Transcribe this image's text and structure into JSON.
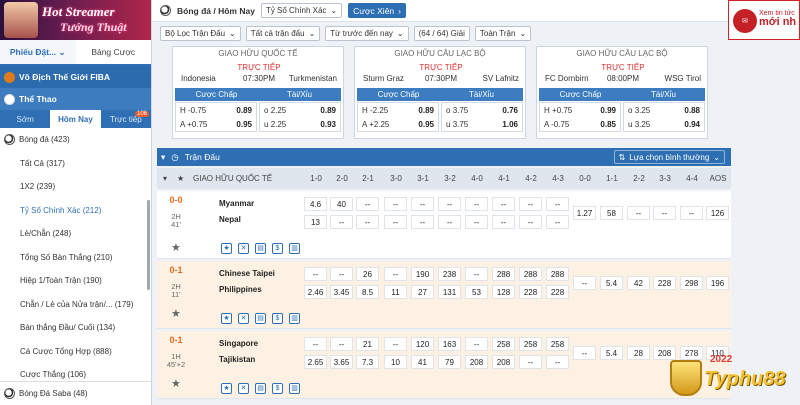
{
  "banner": {
    "line1": "Hot Streamer",
    "line2": "Tướng Thuật"
  },
  "sidebar": {
    "tabs": [
      "Phiếu Đặt...",
      "Bảng Cược"
    ],
    "fiba": "Vô Địch Thế Giới FIBA",
    "sport": "Thể Thao",
    "subtabs": [
      "Sớm",
      "Hôm Nay",
      "Trực tiếp"
    ],
    "live_badge": "106",
    "football": "Bóng đá (423)",
    "items": [
      "Tất Cả (317)",
      "1X2 (239)",
      "Tỷ Số Chính Xác (212)",
      "Lẻ/Chẵn (248)",
      "Tổng Số Bàn Thắng (210)",
      "Hiệp 1/Toàn Trận (190)",
      "Chẵn / Lẻ của Nửa trận/... (179)",
      "Bàn thắng Đầu/ Cuối (134)",
      "Cá Cược Tổng Hợp (888)",
      "Cược Thắng (106)"
    ],
    "saba": "Bóng Đá Saba (48)"
  },
  "topbar": {
    "title": "Bóng đá / Hôm Nay",
    "market": "Tỷ Số Chính Xác",
    "button": "Cược Xiên"
  },
  "filters": {
    "f1": "Bộ Lọc Trận Đấu",
    "f2": "Tất cả trận đấu",
    "f3": "Từ trước đến nay",
    "f4": "(64 / 64) Giải",
    "f5": "Toàn Trận"
  },
  "ad": {
    "small": "Xem tin tức",
    "big": "mới nh"
  },
  "cards": [
    {
      "league": "GIAO HỮU QUỐC TẾ",
      "home": "Indonesia",
      "away": "Turkmenistan",
      "live": "TRỰC TIẾP",
      "time": "07:30PM",
      "h1": "Cược Chấp",
      "h2": "Tài/Xỉu",
      "o": [
        [
          "H",
          "-0.75",
          "0.89"
        ],
        [
          "A",
          "+0.75",
          "0.95"
        ],
        [
          "o",
          "2.25",
          "0.89"
        ],
        [
          "u",
          "2.25",
          "0.93"
        ]
      ]
    },
    {
      "league": "GIAO HỮU CÂU LẠC BỘ",
      "home": "Sturm Graz",
      "away": "SV Lafnitz",
      "live": "TRỰC TIẾP",
      "time": "07:30PM",
      "h1": "Cược Chấp",
      "h2": "Tài/Xỉu",
      "o": [
        [
          "H",
          "-2.25",
          "0.89"
        ],
        [
          "A",
          "+2.25",
          "0.95"
        ],
        [
          "o",
          "3.75",
          "0.76"
        ],
        [
          "u",
          "3.75",
          "1.06"
        ]
      ]
    },
    {
      "league": "GIAO HỮU CÂU LẠC BỘ",
      "home": "FC Dornbirn",
      "away": "WSG Tirol",
      "live": "TRỰC TIẾP",
      "time": "08:00PM",
      "h1": "Cược Chấp",
      "h2": "Tài/Xỉu",
      "o": [
        [
          "H",
          "+0.75",
          "0.99"
        ],
        [
          "A",
          "-0.75",
          "0.85"
        ],
        [
          "o",
          "3.25",
          "0.88"
        ],
        [
          "u",
          "3.25",
          "0.94"
        ]
      ]
    }
  ],
  "table": {
    "title": "Trận Đấu",
    "sort": "Lựa chọn bình thường",
    "league": "GIAO HỮU QUỐC TẾ",
    "cols": [
      "1-0",
      "2-0",
      "2-1",
      "3-0",
      "3-1",
      "3-2",
      "4-0",
      "4-1",
      "4-2",
      "4-3",
      "0-0",
      "1-1",
      "2-2",
      "3-3",
      "4-4",
      "AOS"
    ],
    "rows": [
      {
        "score": "0-0",
        "half": "2H",
        "min": "41'",
        "home": "Myanmar",
        "away": "Nepal",
        "top": [
          "4.6",
          "40",
          "--",
          "--",
          "--",
          "--",
          "--",
          "--",
          "--",
          "--"
        ],
        "bot": [
          "13",
          "--",
          "--",
          "--",
          "--",
          "--",
          "--",
          "--",
          "--",
          "--"
        ],
        "draw": [
          "1.27",
          "58",
          "--",
          "--",
          "--",
          "126"
        ]
      },
      {
        "score": "0-1",
        "half": "2H",
        "min": "11'",
        "home": "Chinese Taipei",
        "away": "Philippines",
        "top": [
          "--",
          "--",
          "26",
          "--",
          "190",
          "238",
          "--",
          "288",
          "288",
          "288"
        ],
        "bot": [
          "2.46",
          "3.45",
          "8.5",
          "11",
          "27",
          "131",
          "53",
          "128",
          "228",
          "228"
        ],
        "draw": [
          "--",
          "5.4",
          "42",
          "228",
          "298",
          "196"
        ]
      },
      {
        "score": "0-1",
        "half": "1H",
        "min": "45'+2",
        "home": "Singapore",
        "away": "Tajikistan",
        "top": [
          "--",
          "--",
          "21",
          "--",
          "120",
          "163",
          "--",
          "258",
          "258",
          "258"
        ],
        "bot": [
          "2.65",
          "3.65",
          "7.3",
          "10",
          "41",
          "79",
          "208",
          "208",
          "--",
          "--"
        ],
        "draw": [
          "--",
          "5.4",
          "28",
          "208",
          "278",
          "110"
        ]
      }
    ]
  },
  "logo": {
    "text": "Typhu88",
    "year": "2022"
  }
}
